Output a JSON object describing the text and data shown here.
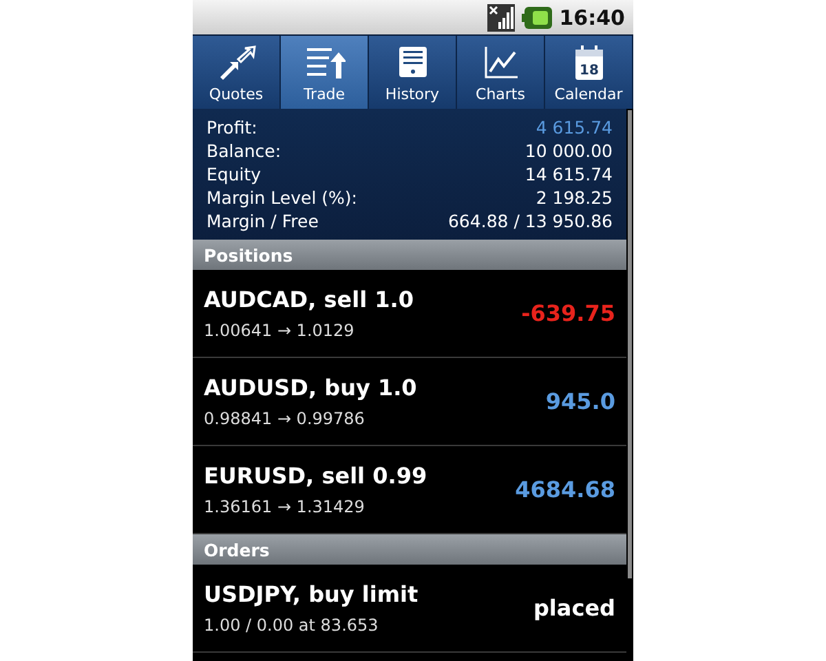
{
  "status_bar": {
    "time": "16:40"
  },
  "tabs": [
    {
      "label": "Quotes",
      "kind": "arrows",
      "selected": false
    },
    {
      "label": "Trade",
      "kind": "list",
      "selected": true
    },
    {
      "label": "History",
      "kind": "doc",
      "selected": false
    },
    {
      "label": "Charts",
      "kind": "chart",
      "selected": false
    },
    {
      "label": "Calendar",
      "kind": "calendar",
      "icon_text": "18",
      "selected": false
    }
  ],
  "summary": [
    {
      "label": "Profit:",
      "value": "4 615.74",
      "color": "#5a9be0"
    },
    {
      "label": "Balance:",
      "value": "10 000.00",
      "color": "#ffffff"
    },
    {
      "label": "Equity",
      "value": "14 615.74",
      "color": "#ffffff"
    },
    {
      "label": "Margin Level (%):",
      "value": "2 198.25",
      "color": "#ffffff"
    },
    {
      "label": "Margin / Free",
      "value": "664.88 / 13 950.86",
      "color": "#ffffff"
    }
  ],
  "sections": [
    {
      "title": "Positions",
      "rows": [
        {
          "title": "AUDCAD, sell 1.0",
          "detail": "1.00641 → 1.0129",
          "value": "-639.75",
          "color": "#e8231c"
        },
        {
          "title": "AUDUSD, buy 1.0",
          "detail": "0.98841 → 0.99786",
          "value": "945.0",
          "color": "#5a9be0"
        },
        {
          "title": "EURUSD, sell 0.99",
          "detail": "1.36161 → 1.31429",
          "value": "4684.68",
          "color": "#5a9be0"
        }
      ]
    },
    {
      "title": "Orders",
      "rows": [
        {
          "title": "USDJPY, buy limit",
          "detail": "1.00 / 0.00 at 83.653",
          "value": "placed",
          "color": "#ffffff"
        }
      ]
    }
  ]
}
